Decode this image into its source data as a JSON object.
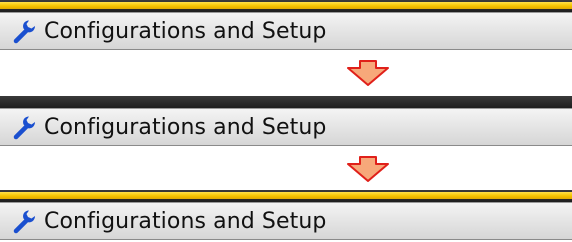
{
  "colors": {
    "accent": "#f5c400",
    "header_dark": "#2b2b2b",
    "bar_light": "#e6e6e6",
    "arrow_fill": "#f7a87a",
    "arrow_stroke": "#e0201a",
    "wrench": "#1a4fcf"
  },
  "panels": [
    {
      "label": "Configurations and Setup",
      "icon": "wrench-icon",
      "state": "accent-on"
    },
    {
      "label": "Configurations and Setup",
      "icon": "wrench-icon",
      "state": "accent-off"
    },
    {
      "label": "Configurations and Setup",
      "icon": "wrench-icon",
      "state": "accent-on"
    }
  ],
  "arrows": [
    {
      "icon": "down-arrow-icon"
    },
    {
      "icon": "down-arrow-icon"
    }
  ]
}
